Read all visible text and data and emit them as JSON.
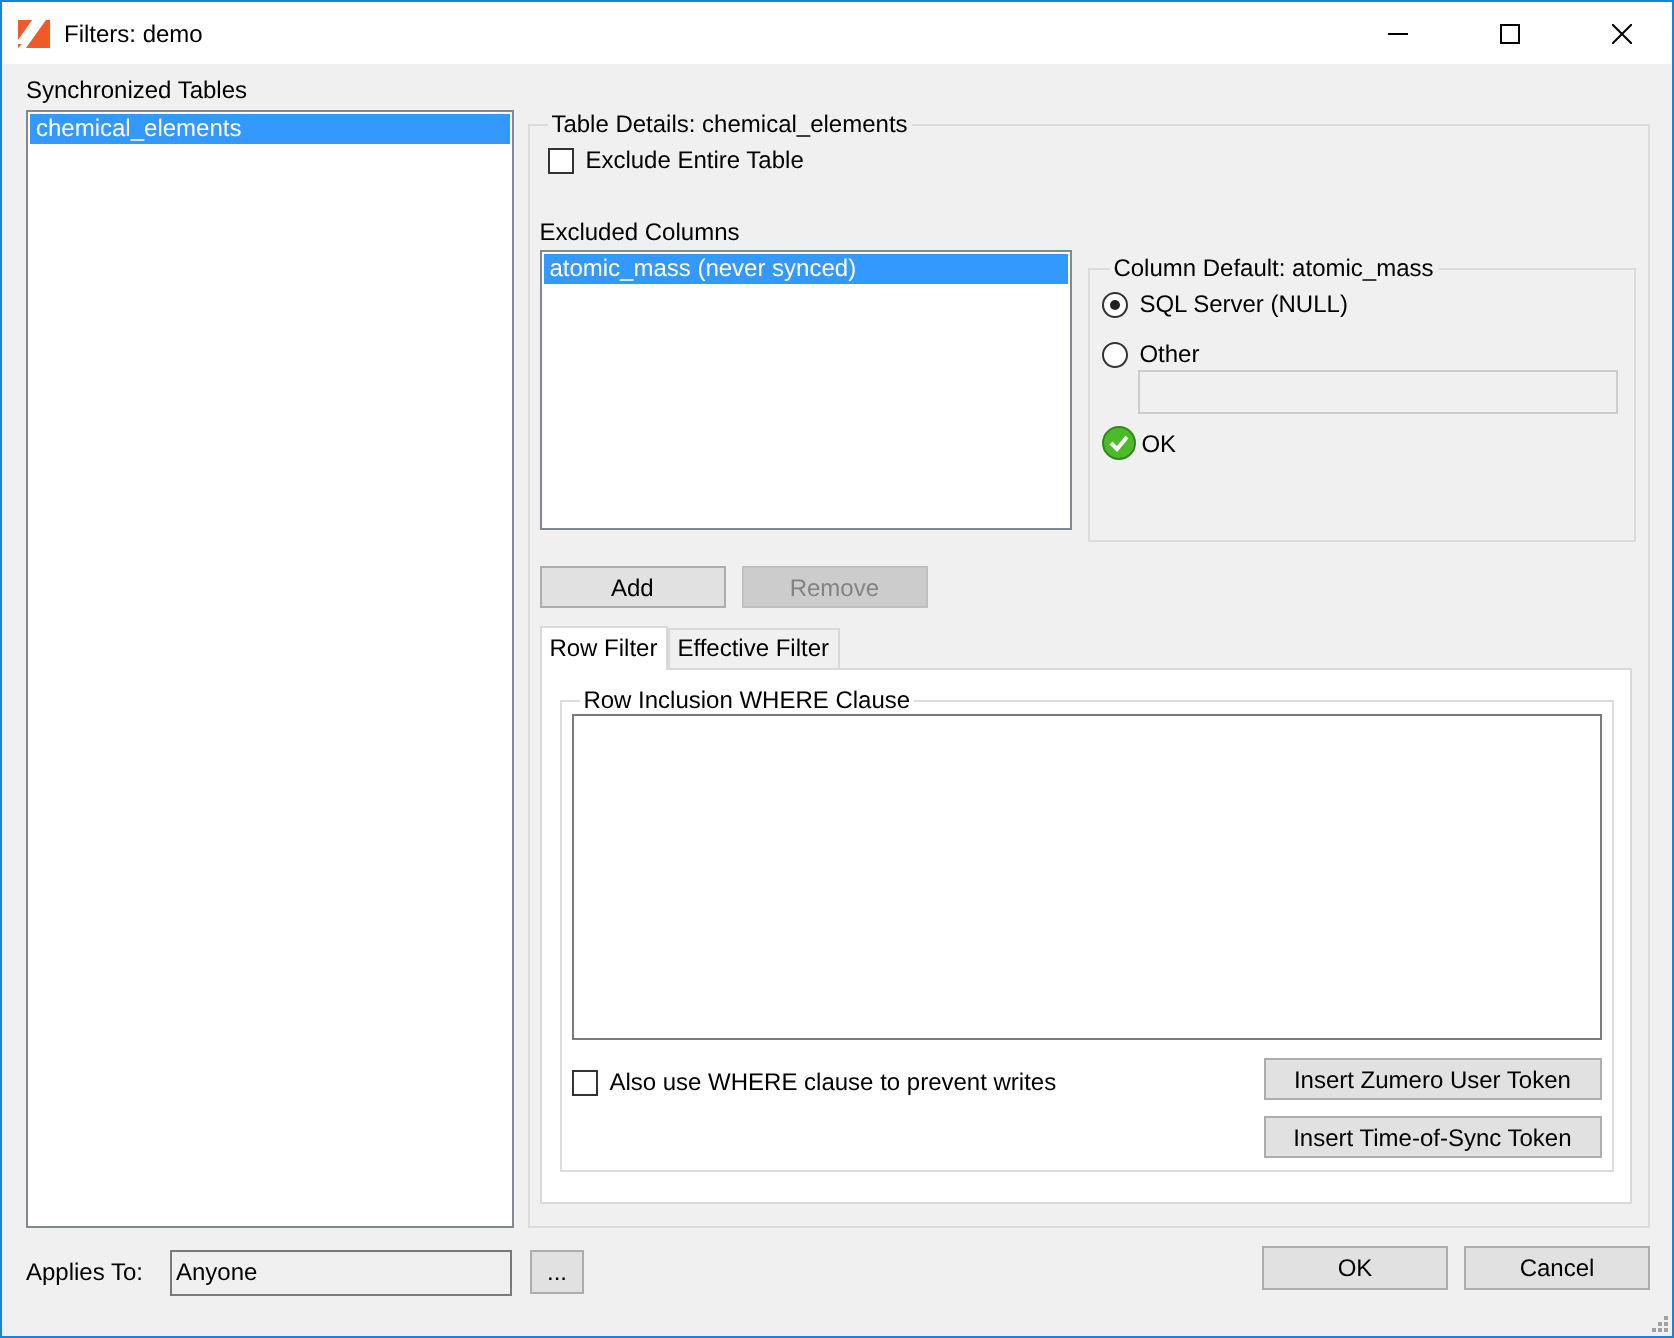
{
  "window": {
    "title": "Filters: demo"
  },
  "synchronized_tables": {
    "label": "Synchronized Tables",
    "items": [
      {
        "text": "chemical_elements",
        "selected": true
      }
    ]
  },
  "table_details": {
    "title": "Table Details: chemical_elements",
    "exclude_entire_table": {
      "label": "Exclude Entire Table",
      "checked": false
    },
    "excluded_columns": {
      "label": "Excluded Columns",
      "items": [
        {
          "text": "atomic_mass (never synced)",
          "selected": true
        }
      ]
    },
    "column_default": {
      "title": "Column Default: atomic_mass",
      "options": [
        {
          "label": "SQL Server (NULL)",
          "selected": true
        },
        {
          "label": "Other",
          "selected": false
        }
      ],
      "status": "OK"
    },
    "buttons": [
      {
        "label": "Add",
        "disabled": false
      },
      {
        "label": "Remove",
        "disabled": true
      }
    ],
    "tabs": [
      {
        "label": "Row Filter",
        "selected": true
      },
      {
        "label": "Effective Filter",
        "selected": false
      }
    ],
    "row_filter": {
      "title": "Row Inclusion WHERE Clause",
      "prevent_writes": {
        "label": "Also use WHERE clause to prevent writes",
        "checked": false
      },
      "buttons": [
        "Insert Zumero User Token",
        "Insert Time-of-Sync Token"
      ]
    }
  },
  "applies_to": {
    "label": "Applies To:",
    "value": "Anyone",
    "browse_button": "..."
  },
  "dialog_buttons": [
    "OK",
    "Cancel"
  ]
}
